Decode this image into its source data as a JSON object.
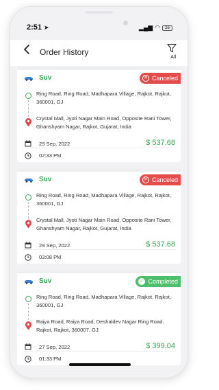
{
  "status": {
    "time": "2:51",
    "battery": "26"
  },
  "header": {
    "title": "Order History",
    "filter_label": "All"
  },
  "orders": [
    {
      "vehicle": "Suv",
      "status": "Canceled",
      "pickup": "Ring Road, Ring Road, Madhapara Village, Rajkot, Rajkot, 360001, GJ",
      "drop": "Crystal Mall, Jyoti Nagar Main Road, Opposite Rani Tower, Ghanshyam Nagar, Rajkot, Gujarat, India",
      "date": "29 Sep, 2022",
      "price": "$ 537.68",
      "time": "02:33 PM"
    },
    {
      "vehicle": "Suv",
      "status": "Canceled",
      "pickup": "Ring Road, Ring Road, Madhapara Village, Rajkot, Rajkot, 360001, GJ",
      "drop": "Crystal Mall, Jyoti Nagar Main Road, Opposite Rani Tower, Ghanshyam Nagar, Rajkot, Gujarat, India",
      "date": "29 Sep, 2022",
      "price": "$ 537.68",
      "time": "03:08 PM"
    },
    {
      "vehicle": "Suv",
      "status": "Completed",
      "pickup": "Ring Road, Ring Road, Madhapara Village, Rajkot, Rajkot, 360001, GJ",
      "drop": "Raiya Road, Raiya Road, Deshaldev Nagar Ring Road, Rajkot, Rajkot, 360007, GJ",
      "date": "27 Sep, 2022",
      "price": "$ 399.04",
      "time": "01:33 PM"
    }
  ],
  "colors": {
    "accent_green": "#3aa657",
    "canceled_red": "#e54b4b",
    "completed_green": "#4cc06a",
    "car_blue": "#3b7fd6"
  },
  "icons": [
    "back-arrow-icon",
    "filter-icon",
    "car-icon",
    "cancel-icon",
    "check-icon",
    "pickup-circle-icon",
    "location-pin-icon",
    "calendar-icon",
    "clock-icon"
  ]
}
